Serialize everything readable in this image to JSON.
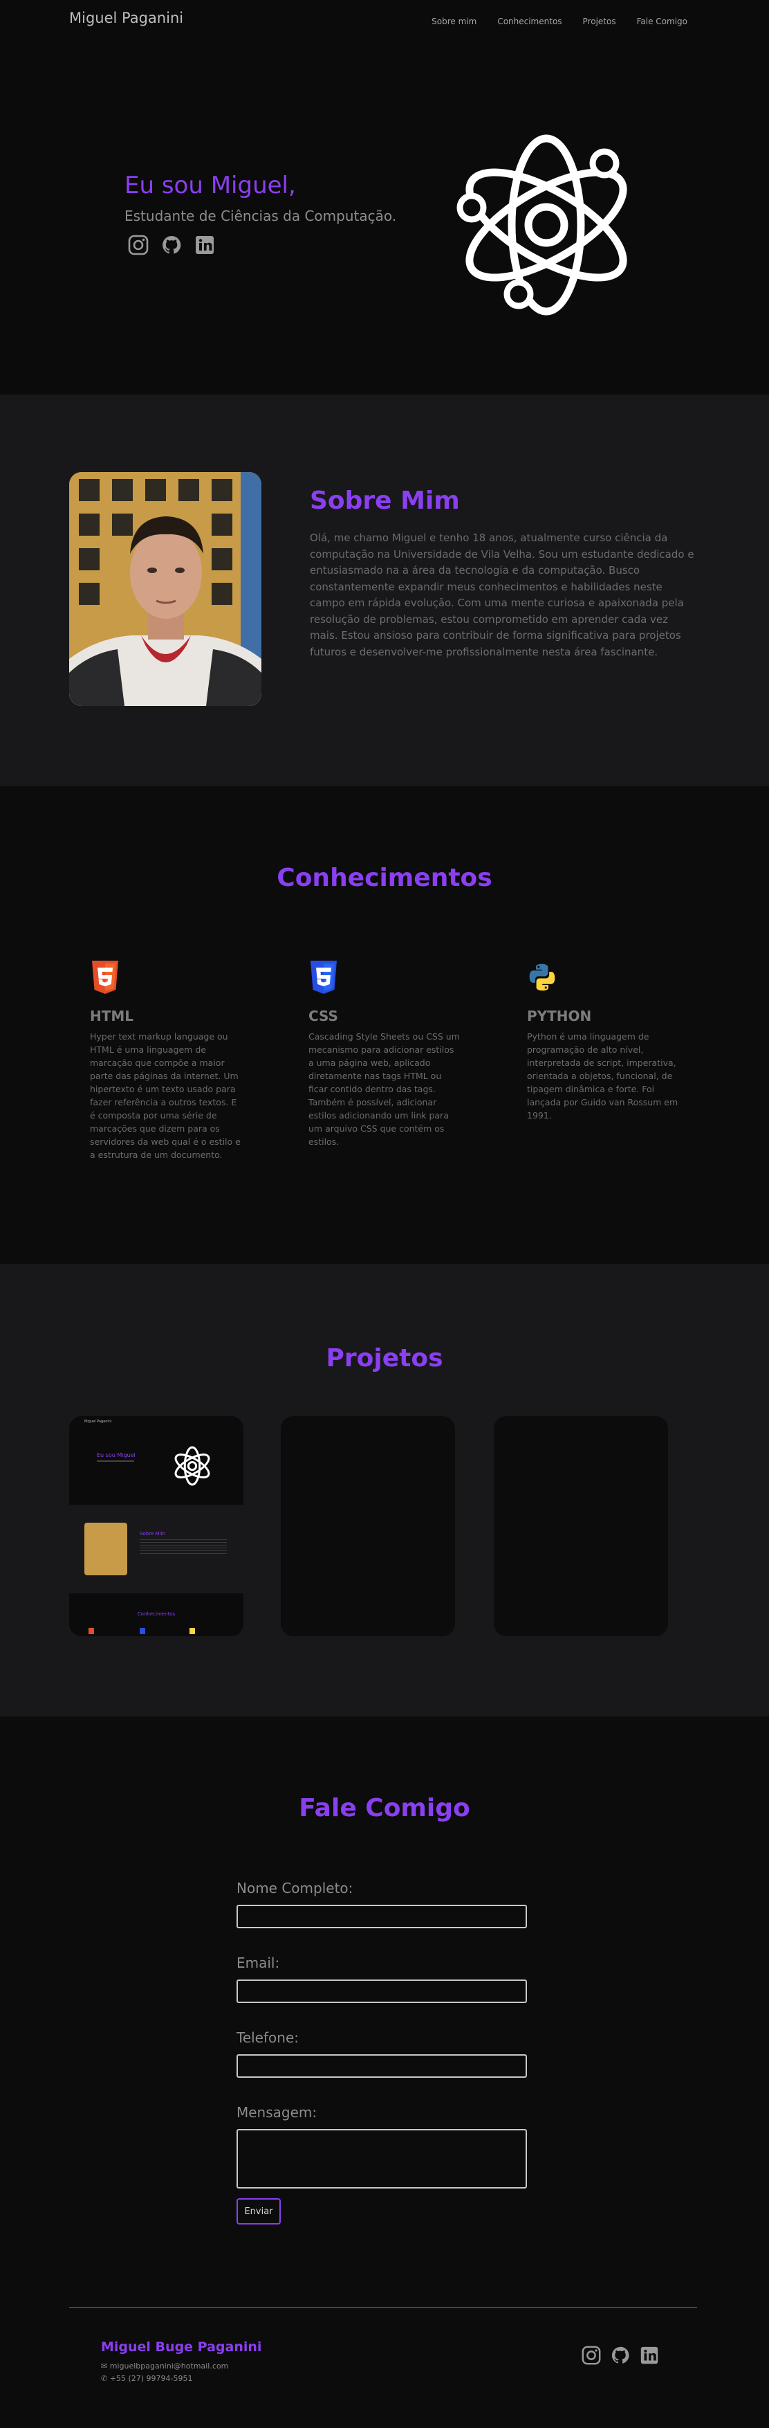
{
  "nav": {
    "brand": "Miguel Paganini",
    "links": [
      "Sobre mim",
      "Conhecimentos",
      "Projetos",
      "Fale Comigo"
    ]
  },
  "hero": {
    "title": "Eu sou Miguel,",
    "subtitle": "Estudante de Ciências da Computação.",
    "socials": [
      "instagram-icon",
      "github-icon",
      "linkedin-icon"
    ],
    "illustration": "atom-icon"
  },
  "about": {
    "title": "Sobre Mim",
    "text": "Olá, me chamo Miguel e tenho 18 anos, atualmente curso ciência da computação na Universidade de Vila Velha. Sou um estudante dedicado e entusiasmado na a área da tecnologia e da computação. Busco constantemente expandir meus conhecimentos e habilidades neste campo em rápida evolução. Com uma mente curiosa e apaixonada pela resolução de problemas, estou comprometido em aprender cada vez mais. Estou ansioso para contribuir de forma significativa para projetos futuros e desenvolver-me profissionalmente nesta área fascinante."
  },
  "skills": {
    "title": "Conhecimentos",
    "items": [
      {
        "name": "HTML",
        "icon": "html5-icon",
        "text": "Hyper text markup language ou HTML é uma linguagem de marcação que compõe a maior parte das páginas da internet. Um hipertexto é um texto usado para fazer referência a outros textos. E é composta por uma série de marcações que dizem para os servidores da web qual é o estilo e a estrutura de um documento."
      },
      {
        "name": "CSS",
        "icon": "css3-icon",
        "text": "Cascading Style Sheets ou CSS um mecanismo para adicionar estilos a uma página web, aplicado diretamente nas tags HTML ou ficar contido dentro das tags. Também é possível, adicionar estilos adicionando um link para um arquivo CSS que contém os estilos."
      },
      {
        "name": "PYTHON",
        "icon": "python-icon",
        "text": "Python é uma linguagem de programação de alto nível, interpretada de script, imperativa, orientada a objetos, funcional, de tipagem dinâmica e forte. Foi lançada por Guido van Rossum em 1991."
      }
    ]
  },
  "projects": {
    "title": "Projetos",
    "cards": [
      {
        "preview": {
          "brand": "Miguel Paganini",
          "hero": "Eu sou Miguel",
          "about": "Sobre Mim",
          "skills": "Conhecimentos"
        }
      },
      {},
      {}
    ]
  },
  "contact": {
    "title": "Fale Comigo",
    "fields": [
      {
        "label": "Nome Completo:",
        "value": ""
      },
      {
        "label": "Email:",
        "value": ""
      },
      {
        "label": "Telefone:",
        "value": ""
      },
      {
        "label": "Mensagem:",
        "value": ""
      }
    ],
    "submit": "Enviar"
  },
  "footer": {
    "name": "Miguel Buge Paganini",
    "email": "miguelbpaganini@hotmail.com",
    "phone": "+55 (27) 99794-5951",
    "socials": [
      "instagram-icon",
      "github-icon",
      "linkedin-icon"
    ]
  },
  "colors": {
    "accent": "#8a3ff0",
    "background": "#0c0c0d",
    "section_alt": "#18181a"
  }
}
